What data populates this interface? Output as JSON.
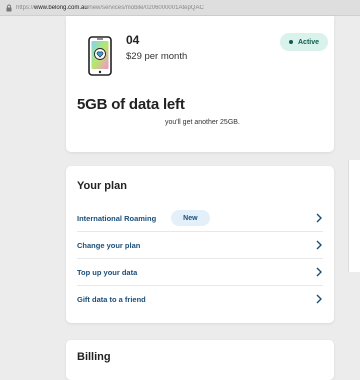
{
  "browser": {
    "url_prefix": "https://",
    "url_domain": "www.belong.com.au",
    "url_path": "/new/services/mobile/0206000001AtepQAC"
  },
  "service": {
    "phone_number": "04",
    "price": "$29 per month",
    "status": "Active",
    "data_left": "5GB of data left",
    "data_note": "you'll get another 25GB."
  },
  "plan": {
    "title": "Your plan",
    "items": [
      {
        "label": "International Roaming",
        "badge": "New"
      },
      {
        "label": "Change your plan"
      },
      {
        "label": "Top up your data"
      },
      {
        "label": "Gift data to a friend"
      }
    ]
  },
  "billing": {
    "title": "Billing"
  },
  "colors": {
    "link": "#1a4f7a",
    "active_badge_bg": "#d9f2ec",
    "new_badge_bg": "#e3f0fa"
  }
}
